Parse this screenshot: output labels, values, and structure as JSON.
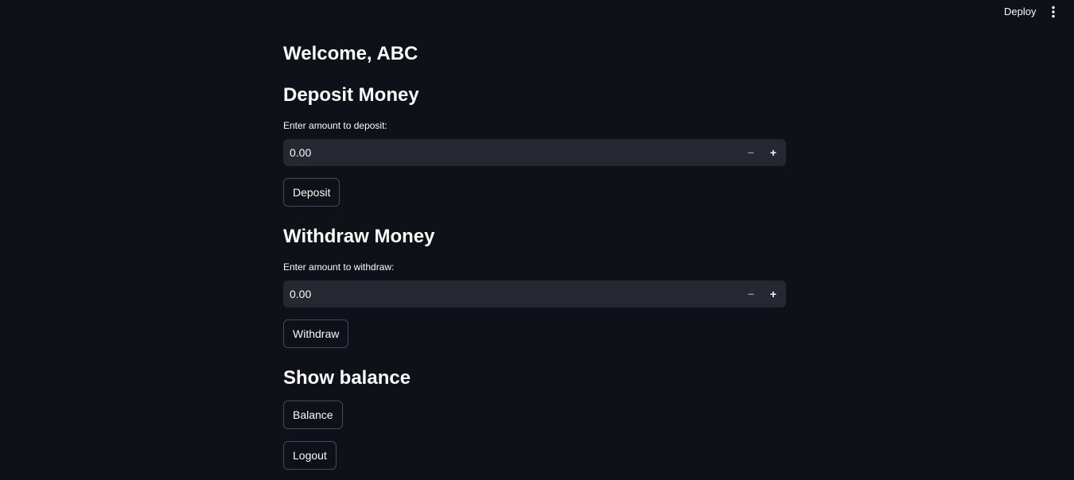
{
  "header": {
    "deploy_label": "Deploy",
    "menu_icon": "vertical-ellipsis-icon"
  },
  "main": {
    "welcome_title": "Welcome, ABC",
    "deposit": {
      "heading": "Deposit Money",
      "label": "Enter amount to deposit:",
      "value": "0.00",
      "minus": "−",
      "plus": "+",
      "button_label": "Deposit"
    },
    "withdraw": {
      "heading": "Withdraw Money",
      "label": "Enter amount to withdraw:",
      "value": "0.00",
      "minus": "−",
      "plus": "+",
      "button_label": "Withdraw"
    },
    "balance": {
      "heading": "Show balance",
      "button_label": "Balance"
    },
    "logout_label": "Logout"
  },
  "colors": {
    "background": "#0e1117",
    "input_background": "#262730",
    "text": "#fafafa",
    "button_border": "#464a54"
  }
}
